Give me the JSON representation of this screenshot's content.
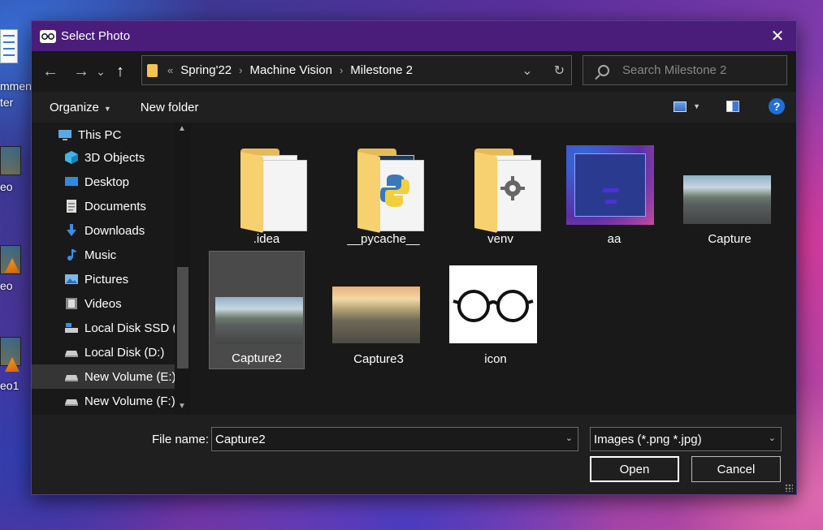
{
  "desktop": {
    "labels": [
      "mmen.",
      "ter",
      "eo",
      "eo",
      "eo1"
    ]
  },
  "dialog": {
    "title": "Select Photo",
    "close_glyph": "✕"
  },
  "nav": {
    "back": "←",
    "forward": "→",
    "recent": "⌄",
    "up": "↑",
    "overflow": "«",
    "breadcrumbs": [
      "Spring'22",
      "Machine Vision",
      "Milestone 2"
    ],
    "search_placeholder": "Search Milestone 2"
  },
  "toolbar": {
    "organize": "Organize",
    "new_folder": "New folder",
    "help": "?"
  },
  "sidebar": {
    "items": [
      {
        "label": "This PC",
        "icon": "this-pc-icon"
      },
      {
        "label": "3D Objects",
        "icon": "3d-objects-icon"
      },
      {
        "label": "Desktop",
        "icon": "desktop-icon"
      },
      {
        "label": "Documents",
        "icon": "documents-icon"
      },
      {
        "label": "Downloads",
        "icon": "downloads-icon"
      },
      {
        "label": "Music",
        "icon": "music-icon"
      },
      {
        "label": "Pictures",
        "icon": "pictures-icon"
      },
      {
        "label": "Videos",
        "icon": "videos-icon"
      },
      {
        "label": "Local Disk SSD (C",
        "icon": "drive-icon"
      },
      {
        "label": "Local Disk (D:)",
        "icon": "drive-icon"
      },
      {
        "label": "New Volume (E:)",
        "icon": "drive-icon",
        "selected": true
      },
      {
        "label": "New Volume (F:)",
        "icon": "drive-icon"
      }
    ]
  },
  "files": [
    {
      "name": ".idea",
      "kind": "folder"
    },
    {
      "name": "__pycache__",
      "kind": "folder-python"
    },
    {
      "name": "venv",
      "kind": "folder-settings"
    },
    {
      "name": "aa",
      "kind": "image-app"
    },
    {
      "name": "Capture",
      "kind": "image-road"
    },
    {
      "name": "Capture2",
      "kind": "image-road",
      "selected": true
    },
    {
      "name": "Capture3",
      "kind": "image-road-sunset"
    },
    {
      "name": "icon",
      "kind": "image-glasses"
    }
  ],
  "footer": {
    "file_name_label": "File name:",
    "file_name_value": "Capture2",
    "filter_value": "Images (*.png *.jpg)",
    "open_label": "Open",
    "cancel_label": "Cancel"
  },
  "colors": {
    "titlebar": "#4a1d7a",
    "dialog_bg": "#191919",
    "folder": "#f7d070",
    "accent": "#1f6fd8"
  }
}
